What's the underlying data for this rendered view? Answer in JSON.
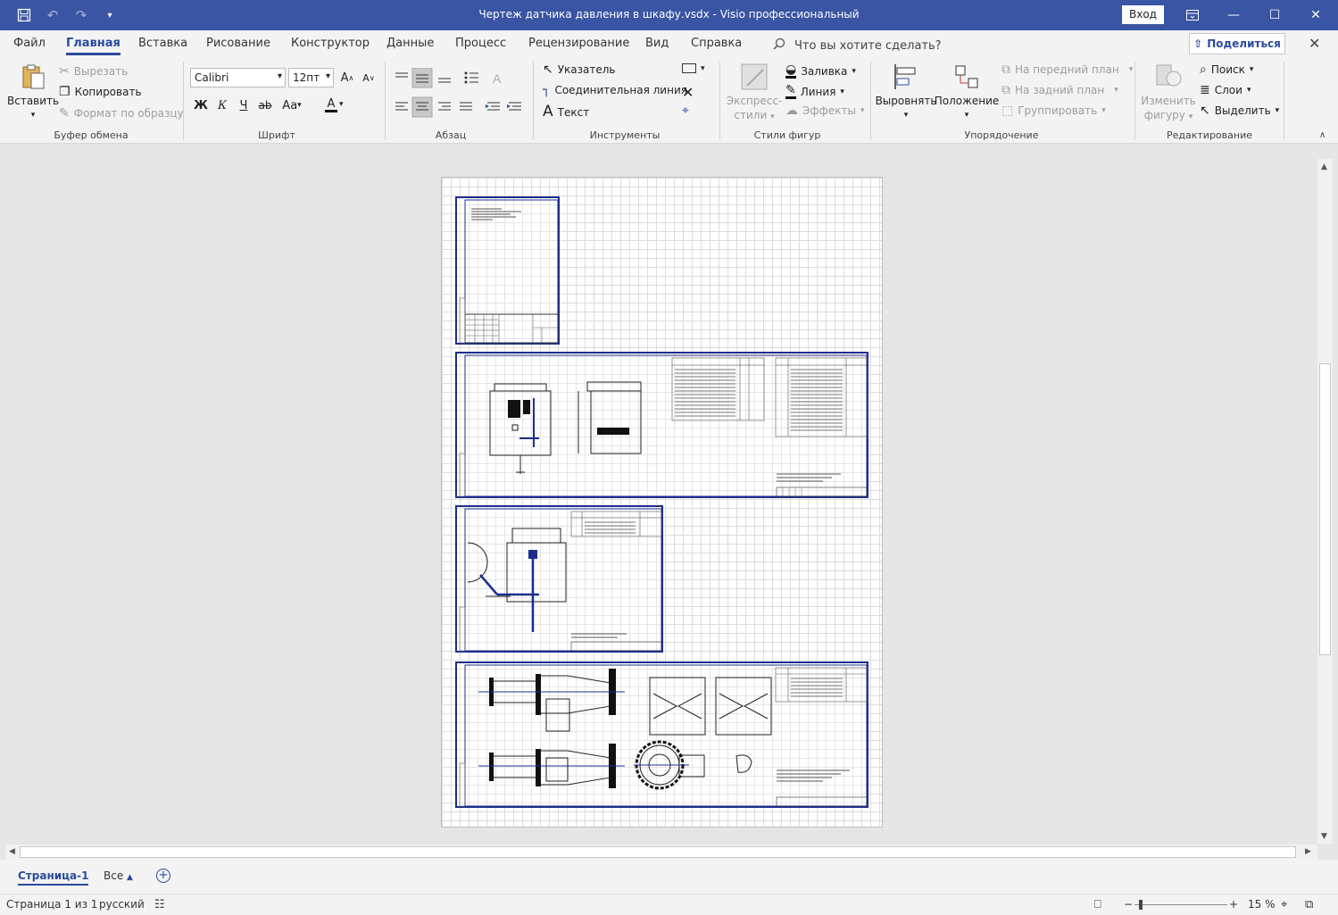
{
  "window": {
    "title": "Чертеж датчика давления в шкафу.vsdx  -  Visio профессиональный",
    "sign_in": "Вход"
  },
  "menu": {
    "tabs": [
      "Файл",
      "Главная",
      "Вставка",
      "Рисование",
      "Конструктор",
      "Данные",
      "Процесс",
      "Рецензирование",
      "Вид",
      "Справка"
    ],
    "active_tab": "Главная",
    "tell_me": "Что вы хотите сделать?",
    "share": "Поделиться"
  },
  "ribbon": {
    "clipboard": {
      "label": "Буфер обмена",
      "paste": "Вставить",
      "cut": "Вырезать",
      "copy": "Копировать",
      "format_painter": "Формат по образцу"
    },
    "font": {
      "label": "Шрифт",
      "font_name": "Calibri",
      "font_size": "12пт",
      "bold": "Ж",
      "italic": "К",
      "underline": "Ч",
      "strike": "ab",
      "case": "Aa",
      "color_letter": "A",
      "grow": "A",
      "shrink": "A"
    },
    "paragraph": {
      "label": "Абзац"
    },
    "tools": {
      "label": "Инструменты",
      "pointer": "Указатель",
      "connector": "Соединительная линия",
      "text": "Текст"
    },
    "shape_styles": {
      "label": "Стили фигур",
      "quick_styles_line1": "Экспресс-",
      "quick_styles_line2": "стили",
      "fill": "Заливка",
      "line": "Линия",
      "effects": "Эффекты"
    },
    "arrange": {
      "label": "Упорядочение",
      "align": "Выровнять",
      "position": "Положение",
      "bring_front": "На передний план",
      "send_back": "На задний план",
      "group": "Группировать"
    },
    "editing": {
      "label": "Редактирование",
      "change_shape_line1": "Изменить",
      "change_shape_line2": "фигуру",
      "find": "Поиск",
      "layers": "Слои",
      "select": "Выделить"
    }
  },
  "page_tabs": {
    "current": "Страница-1",
    "all": "Все"
  },
  "status": {
    "page": "Страница 1 из 1",
    "language": "русский",
    "zoom": "15 %"
  },
  "colors": {
    "title_bar": "#3955a3",
    "accent": "#2b4a9b",
    "sheet_border": "#1c2e8f"
  }
}
